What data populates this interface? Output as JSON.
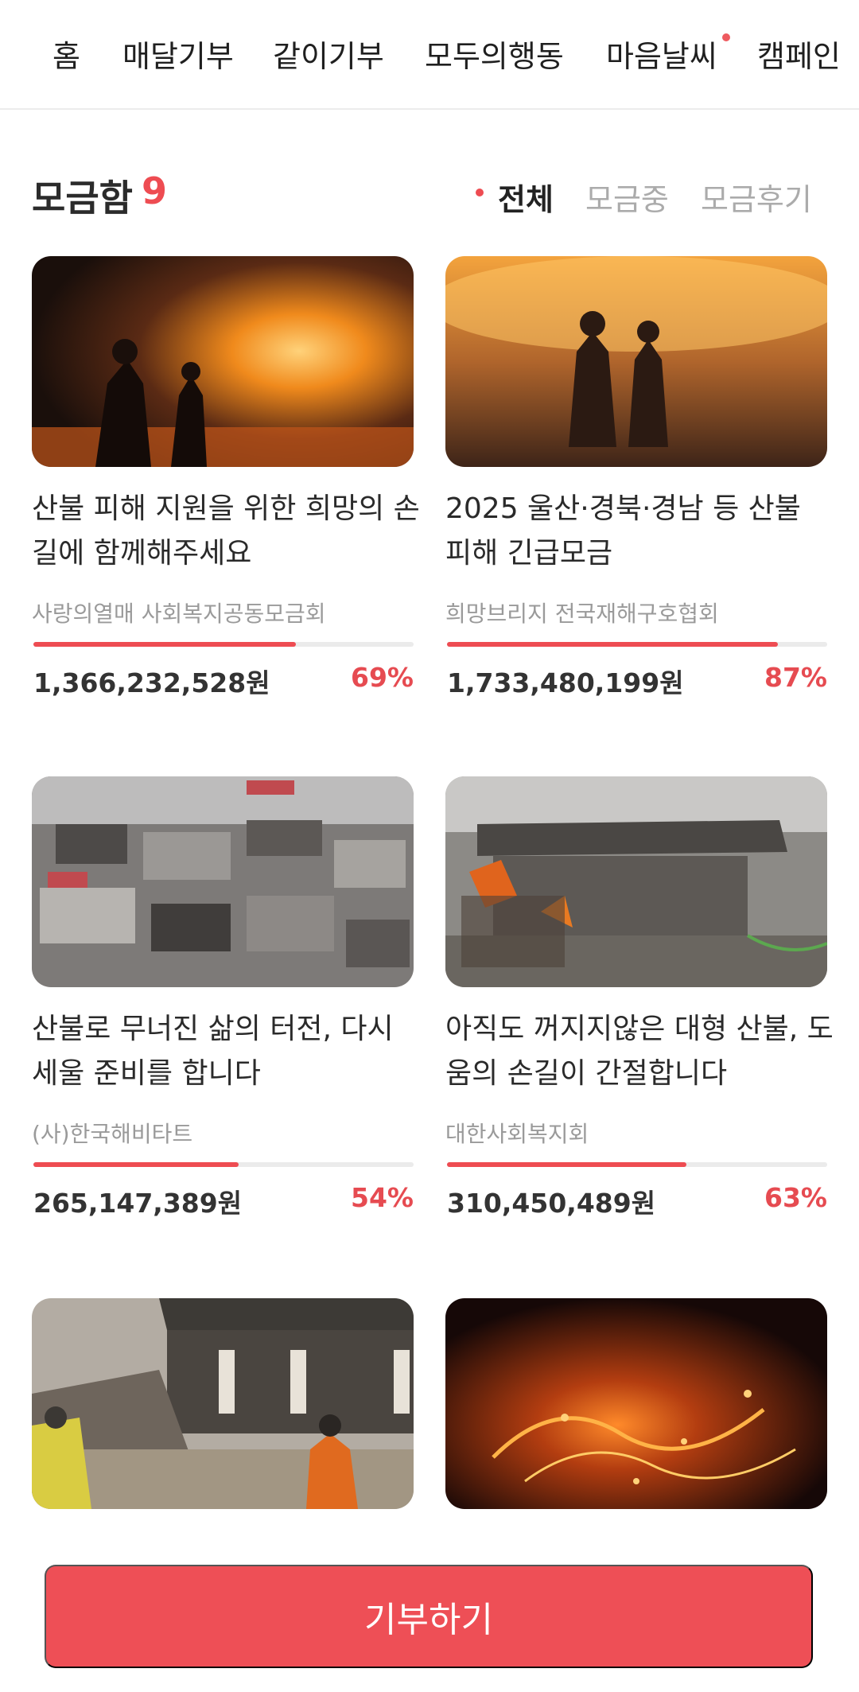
{
  "nav": {
    "items": [
      "홈",
      "매달기부",
      "같이기부",
      "모두의행동",
      "마음날씨",
      "캠페인"
    ]
  },
  "section": {
    "title": "모금함",
    "count": "9"
  },
  "filters": [
    "전체",
    "모금중",
    "모금후기"
  ],
  "cards": [
    {
      "title": "산불 피해 지원을 위한 희망의 손길에 함께해주세요",
      "org": "사랑의열매 사회복지공동모금회",
      "amount": "1,366,232,528원",
      "percent": "69%",
      "progress": 0.69
    },
    {
      "title": "2025 울산·경북·경남 등 산불 피해 긴급모금",
      "org": "희망브리지 전국재해구호협회",
      "amount": "1,733,480,199원",
      "percent": "87%",
      "progress": 0.87
    },
    {
      "title": "산불로 무너진 삶의 터전, 다시 세울 준비를 합니다",
      "org": "(사)한국해비타트",
      "amount": "265,147,389원",
      "percent": "54%",
      "progress": 0.54
    },
    {
      "title": "아직도 꺼지지않은 대형 산불, 도움의 손길이 간절합니다",
      "org": "대한사회복지회",
      "amount": "310,450,489원",
      "percent": "63%",
      "progress": 0.63
    }
  ],
  "donate_button": "기부하기",
  "colors": {
    "accent": "#ee4c52"
  }
}
